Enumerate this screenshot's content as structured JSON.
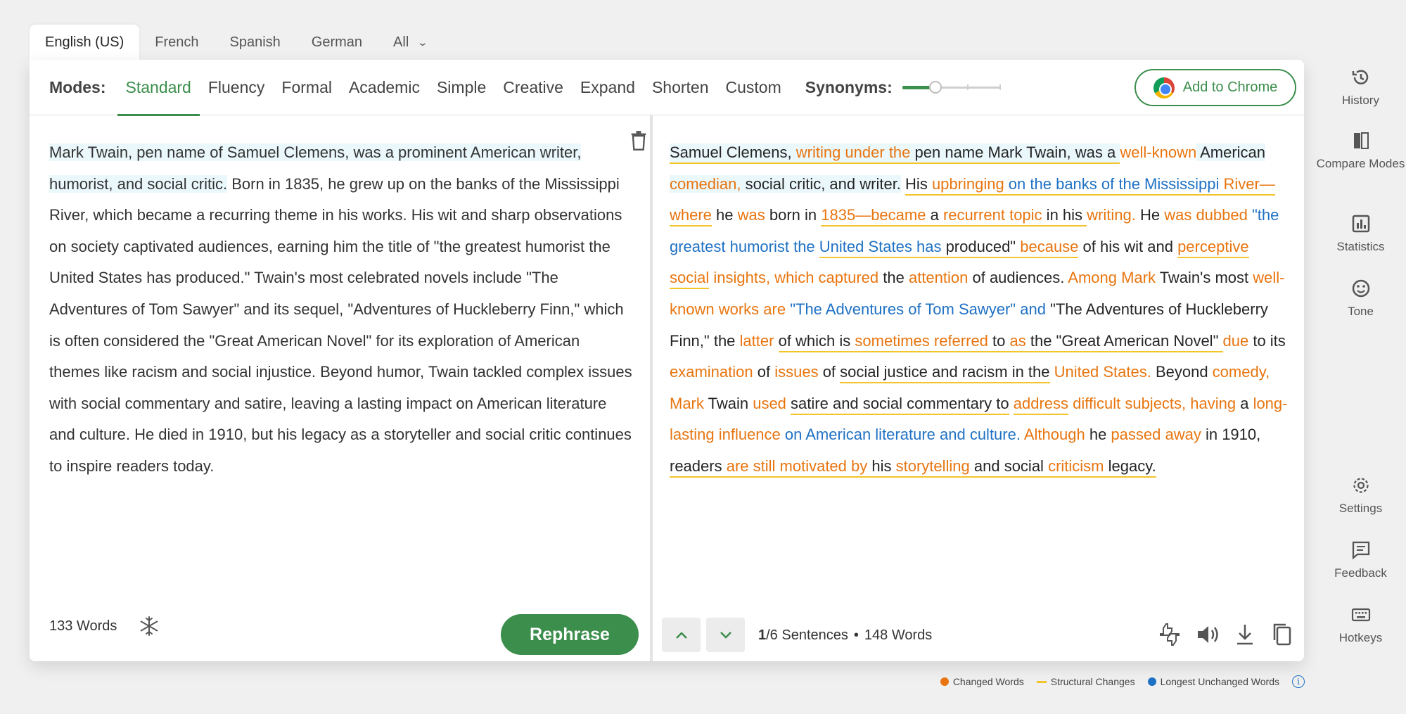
{
  "languages": {
    "tabs": [
      "English (US)",
      "French",
      "Spanish",
      "German"
    ],
    "all_label": "All"
  },
  "modes": {
    "label": "Modes:",
    "items": [
      "Standard",
      "Fluency",
      "Formal",
      "Academic",
      "Simple",
      "Creative",
      "Expand",
      "Shorten",
      "Custom"
    ],
    "active": "Standard"
  },
  "synonyms": {
    "label": "Synonyms:",
    "level": 0.3
  },
  "chrome_button": "Add to Chrome",
  "input": {
    "highlighted": "Mark Twain, pen name of Samuel Clemens, was a prominent American writer, humorist, and social critic.",
    "rest": " Born in 1835, he grew up on the banks of the Mississippi River, which became a recurring theme in his works. His wit and sharp observations on society captivated audiences, earning him the title of \"the greatest humorist the United States has produced.\" Twain's most celebrated novels include \"The Adventures of Tom Sawyer\" and its sequel, \"Adventures of Huckleberry Finn,\" which is often considered the \"Great American Novel\" for its exploration of American themes like racism and social injustice. Beyond humor, Twain tackled complex issues with social commentary and satire, leaving a lasting impact on American literature and culture. He died in 1910, but his legacy as a storyteller and social critic continues to inspire readers today.",
    "word_count": "133 Words"
  },
  "rephrase_button": "Rephrase",
  "output": {
    "segments": [
      {
        "t": "Samuel Clemens, ",
        "c": "n",
        "h": 1,
        "u": 1
      },
      {
        "t": "writing under the",
        "c": "o",
        "h": 1,
        "u": 1
      },
      {
        "t": " pen name Mark Twain, was a ",
        "c": "n",
        "h": 1,
        "u": 1
      },
      {
        "t": "well-known",
        "c": "o",
        "h": 0,
        "u": 0
      },
      {
        "t": " American ",
        "c": "n",
        "h": 1,
        "u": 0
      },
      {
        "t": "comedian,",
        "c": "o",
        "h": 1,
        "u": 0
      },
      {
        "t": " social critic, and writer.",
        "c": "n",
        "h": 1,
        "u": 0
      },
      {
        "t": " ",
        "c": "n",
        "h": 0,
        "u": 0
      },
      {
        "t": "His ",
        "c": "n",
        "h": 0,
        "u": 1
      },
      {
        "t": "upbringing",
        "c": "o",
        "h": 0,
        "u": 1
      },
      {
        "t": " on the banks of the Mississippi",
        "c": "b",
        "h": 0,
        "u": 1
      },
      {
        "t": " River—where",
        "c": "o",
        "h": 0,
        "u": 1
      },
      {
        "t": " he ",
        "c": "n",
        "h": 0,
        "u": 0
      },
      {
        "t": "was",
        "c": "o",
        "h": 0,
        "u": 0
      },
      {
        "t": " born in ",
        "c": "n",
        "h": 0,
        "u": 0
      },
      {
        "t": "1835—became",
        "c": "o",
        "h": 0,
        "u": 1
      },
      {
        "t": " a ",
        "c": "n",
        "h": 0,
        "u": 1
      },
      {
        "t": "recurrent topic",
        "c": "o",
        "h": 0,
        "u": 1
      },
      {
        "t": " in his ",
        "c": "n",
        "h": 0,
        "u": 1
      },
      {
        "t": "writing.",
        "c": "o",
        "h": 0,
        "u": 0
      },
      {
        "t": " He ",
        "c": "n",
        "h": 0,
        "u": 0
      },
      {
        "t": "was dubbed",
        "c": "o",
        "h": 0,
        "u": 0
      },
      {
        "t": " \"the greatest humorist the ",
        "c": "b",
        "h": 0,
        "u": 0
      },
      {
        "t": "United States has",
        "c": "b",
        "h": 0,
        "u": 1
      },
      {
        "t": " produced\" ",
        "c": "n",
        "h": 0,
        "u": 1
      },
      {
        "t": "because",
        "c": "o",
        "h": 0,
        "u": 1
      },
      {
        "t": " of his wit and ",
        "c": "n",
        "h": 0,
        "u": 0
      },
      {
        "t": "perceptive social",
        "c": "o",
        "h": 0,
        "u": 1
      },
      {
        "t": " insights, which captured",
        "c": "o",
        "h": 0,
        "u": 0
      },
      {
        "t": " the ",
        "c": "n",
        "h": 0,
        "u": 0
      },
      {
        "t": "attention",
        "c": "o",
        "h": 0,
        "u": 0
      },
      {
        "t": " of audiences. ",
        "c": "n",
        "h": 0,
        "u": 0
      },
      {
        "t": "Among Mark",
        "c": "o",
        "h": 0,
        "u": 0
      },
      {
        "t": " Twain's most ",
        "c": "n",
        "h": 0,
        "u": 0
      },
      {
        "t": "well-known works are",
        "c": "o",
        "h": 0,
        "u": 0
      },
      {
        "t": " \"The Adventures of Tom Sawyer\" and",
        "c": "b",
        "h": 0,
        "u": 0
      },
      {
        "t": " \"The Adventures of Huckleberry Finn,\" the ",
        "c": "n",
        "h": 0,
        "u": 0
      },
      {
        "t": "latter",
        "c": "o",
        "h": 0,
        "u": 0
      },
      {
        "t": " ",
        "c": "n",
        "h": 0,
        "u": 0
      },
      {
        "t": "of which is ",
        "c": "n",
        "h": 0,
        "u": 1
      },
      {
        "t": "sometimes referred",
        "c": "o",
        "h": 0,
        "u": 1
      },
      {
        "t": " to ",
        "c": "n",
        "h": 0,
        "u": 1
      },
      {
        "t": "as",
        "c": "o",
        "h": 0,
        "u": 1
      },
      {
        "t": " the \"Great American Novel\" ",
        "c": "n",
        "h": 0,
        "u": 1
      },
      {
        "t": "due",
        "c": "o",
        "h": 0,
        "u": 0
      },
      {
        "t": " to its ",
        "c": "n",
        "h": 0,
        "u": 0
      },
      {
        "t": "examination",
        "c": "o",
        "h": 0,
        "u": 0
      },
      {
        "t": " of ",
        "c": "n",
        "h": 0,
        "u": 0
      },
      {
        "t": "issues",
        "c": "o",
        "h": 0,
        "u": 0
      },
      {
        "t": " of ",
        "c": "n",
        "h": 0,
        "u": 0
      },
      {
        "t": "social justice and racism in the",
        "c": "n",
        "h": 0,
        "u": 1
      },
      {
        "t": " United States.",
        "c": "o",
        "h": 0,
        "u": 0
      },
      {
        "t": " Beyond ",
        "c": "n",
        "h": 0,
        "u": 0
      },
      {
        "t": "comedy, Mark",
        "c": "o",
        "h": 0,
        "u": 0
      },
      {
        "t": " Twain ",
        "c": "n",
        "h": 0,
        "u": 0
      },
      {
        "t": "used",
        "c": "o",
        "h": 0,
        "u": 0
      },
      {
        "t": " ",
        "c": "n",
        "h": 0,
        "u": 0
      },
      {
        "t": "satire and social commentary to",
        "c": "n",
        "h": 0,
        "u": 1
      },
      {
        "t": " ",
        "c": "n",
        "h": 0,
        "u": 0
      },
      {
        "t": "address",
        "c": "o",
        "h": 0,
        "u": 1
      },
      {
        "t": " difficult subjects, having",
        "c": "o",
        "h": 0,
        "u": 0
      },
      {
        "t": " a ",
        "c": "n",
        "h": 0,
        "u": 0
      },
      {
        "t": "long-lasting influence",
        "c": "o",
        "h": 0,
        "u": 0
      },
      {
        "t": " on American literature and culture.",
        "c": "b",
        "h": 0,
        "u": 0
      },
      {
        "t": " Although",
        "c": "o",
        "h": 0,
        "u": 0
      },
      {
        "t": " he ",
        "c": "n",
        "h": 0,
        "u": 0
      },
      {
        "t": "passed away",
        "c": "o",
        "h": 0,
        "u": 0
      },
      {
        "t": " in 1910, ",
        "c": "n",
        "h": 0,
        "u": 0
      },
      {
        "t": "readers ",
        "c": "n",
        "h": 0,
        "u": 1
      },
      {
        "t": "are still motivated by",
        "c": "o",
        "h": 0,
        "u": 1
      },
      {
        "t": " his ",
        "c": "n",
        "h": 0,
        "u": 1
      },
      {
        "t": "storytelling",
        "c": "o",
        "h": 0,
        "u": 1
      },
      {
        "t": " and social ",
        "c": "n",
        "h": 0,
        "u": 1
      },
      {
        "t": "criticism",
        "c": "o",
        "h": 0,
        "u": 1
      },
      {
        "t": " legacy.",
        "c": "n",
        "h": 0,
        "u": 1
      }
    ],
    "sentence_current": "1",
    "sentence_rest": "/6 Sentences",
    "word_count": "148 Words"
  },
  "legend": {
    "changed": "Changed Words",
    "structural": "Structural Changes",
    "unchanged": "Longest Unchanged Words",
    "colors": {
      "changed": "#e8750f",
      "structural": "#f3c42c",
      "unchanged": "#1f71c4"
    }
  },
  "sidebar": {
    "history": "History",
    "compare": "Compare Modes",
    "statistics": "Statistics",
    "tone": "Tone",
    "settings": "Settings",
    "feedback": "Feedback",
    "hotkeys": "Hotkeys"
  },
  "colors": {
    "accent": "#3b8e4c",
    "changed": "#e8750f",
    "unchanged": "#1f71c4",
    "structural": "#f3c42c"
  }
}
